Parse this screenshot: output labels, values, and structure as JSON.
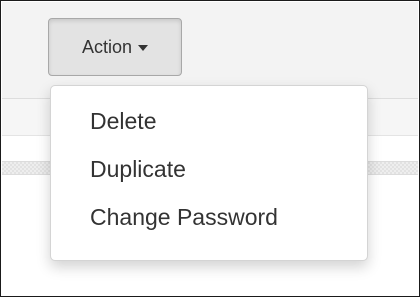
{
  "action_menu": {
    "button_label": "Action",
    "button_icon": "caret-down-icon",
    "items": [
      {
        "label": "Delete"
      },
      {
        "label": "Duplicate"
      },
      {
        "label": "Change Password"
      }
    ]
  },
  "colors": {
    "button_background": "#e3e3e3",
    "menu_background": "#ffffff",
    "text": "#333333"
  }
}
